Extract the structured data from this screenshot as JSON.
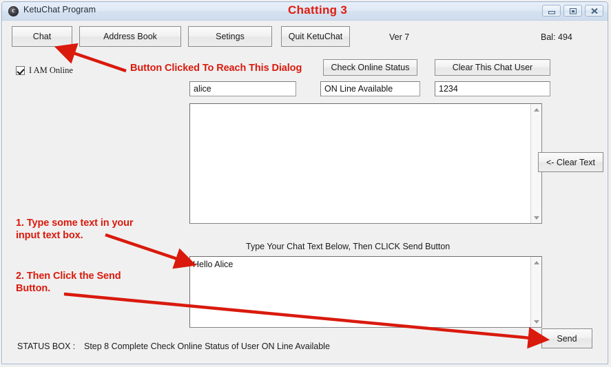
{
  "window": {
    "icon": "app-circle-c-icon",
    "title": "KetuChat Program",
    "center_title": "Chatting  3",
    "controls": {
      "minimize": "minimize-icon",
      "restore": "restore-icon",
      "close": "close-icon"
    }
  },
  "toolbar": {
    "chat": "Chat",
    "address_book": "Address Book",
    "settings": "Setings",
    "quit": "Quit KetuChat",
    "version": "Ver 7",
    "balance": "Bal: 494"
  },
  "status_row": {
    "online_checkbox_label": "I AM Online",
    "online_checked": true,
    "check_online_status": "Check Online Status",
    "clear_this_chat_user": "Clear This Chat User"
  },
  "fields": {
    "user_name": "alice",
    "online_state": "ON Line Available",
    "user_code": "1234"
  },
  "chat_display": {
    "content": "",
    "clear_text_button": "<- Clear Text"
  },
  "input_section": {
    "hint": "Type Your Chat Text Below, Then CLICK Send Button",
    "text": "Hello Alice",
    "send_button": "Send"
  },
  "status_bar": {
    "label": "STATUS BOX :",
    "message": "Step 8 Complete Check Online Status of User ON Line Available"
  },
  "annotations": {
    "button_clicked": "Button Clicked To Reach This Dialog",
    "step_one": "1.  Type some text in your\ninput text box.",
    "step_two": "2.  Then Click the Send\nButton."
  },
  "colors": {
    "annotation_red": "#d91a0d",
    "title_red": "#e01b0e",
    "window_bg": "#f0f0f0"
  }
}
